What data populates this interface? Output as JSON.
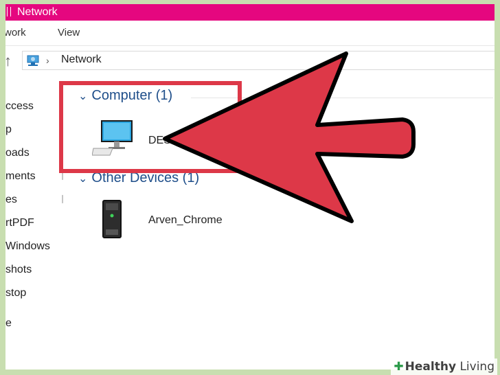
{
  "window": {
    "title": "Network"
  },
  "ribbon": {
    "tabs": [
      "work",
      "View"
    ]
  },
  "address": {
    "location": "Network"
  },
  "nav_pane": {
    "items": [
      "ccess",
      "p",
      "oads",
      "ments",
      "es",
      "rtPDF",
      "Windows",
      "shots",
      "stop",
      "e"
    ]
  },
  "content": {
    "groups": [
      {
        "label": "Computer (1)",
        "items": [
          {
            "name": "DESK"
          }
        ]
      },
      {
        "label": "Other Devices (1)",
        "items": [
          {
            "name": "Arven_Chrome"
          }
        ]
      }
    ]
  },
  "annotation": {
    "arrow_color": "#dd3848",
    "box_color": "#dd3848"
  },
  "watermark": {
    "prefix": "Healthy",
    "suffix": " Living"
  },
  "colors": {
    "titlebar": "#e5077f",
    "group_header": "#1e4e8a",
    "page_border": "#c8deb0"
  },
  "icons": [
    "up-arrow-icon",
    "network-icon",
    "chevron-right-icon",
    "pin-icon",
    "chevron-down-icon",
    "monitor-icon",
    "media-device-icon",
    "plus-icon"
  ]
}
